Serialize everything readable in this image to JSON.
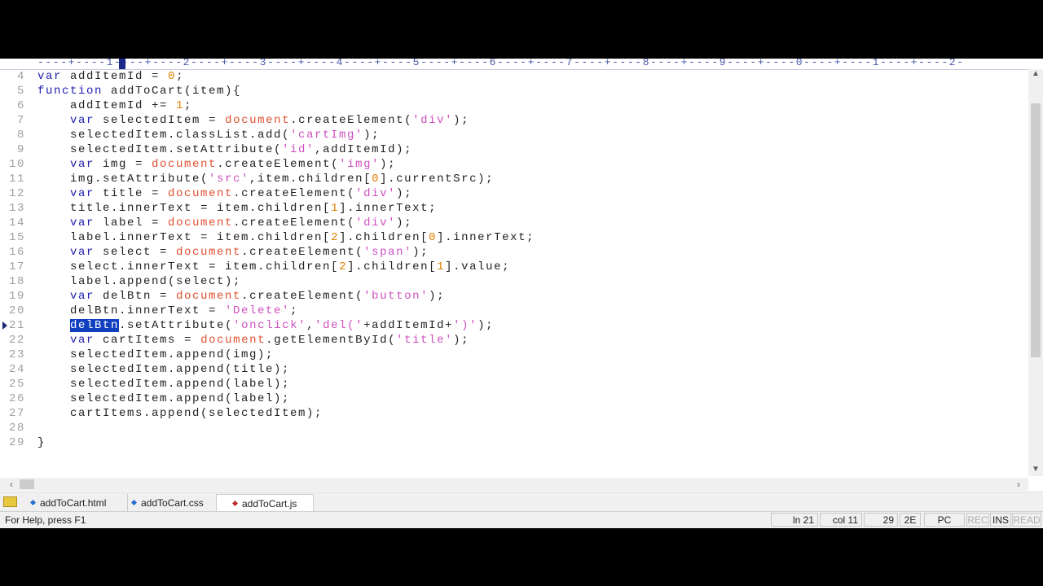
{
  "ruler": "----+----1----+----2----+----3----+----4----+----5----+----6----+----7----+----8----+----9----+----0----+----1----+----2-",
  "code_lines": [
    {
      "num": "4",
      "tokens": [
        [
          "var",
          "k"
        ],
        [
          " addItemId = ",
          "p"
        ],
        [
          "0",
          "n"
        ],
        [
          ";",
          "p"
        ]
      ]
    },
    {
      "num": "5",
      "tokens": [
        [
          "function",
          "k"
        ],
        [
          " addToCart(item){",
          "p"
        ]
      ]
    },
    {
      "num": "6",
      "tokens": [
        [
          "    addItemId += ",
          "p"
        ],
        [
          "1",
          "n"
        ],
        [
          ";",
          "p"
        ]
      ]
    },
    {
      "num": "7",
      "tokens": [
        [
          "    ",
          "p"
        ],
        [
          "var",
          "k"
        ],
        [
          " selectedItem = ",
          "p"
        ],
        [
          "document",
          "d"
        ],
        [
          ".createElement(",
          "p"
        ],
        [
          "'div'",
          "s"
        ],
        [
          ");",
          "p"
        ]
      ]
    },
    {
      "num": "8",
      "tokens": [
        [
          "    selectedItem.classList.add(",
          "p"
        ],
        [
          "'cartImg'",
          "s"
        ],
        [
          ");",
          "p"
        ]
      ]
    },
    {
      "num": "9",
      "tokens": [
        [
          "    selectedItem.setAttribute(",
          "p"
        ],
        [
          "'id'",
          "s"
        ],
        [
          ",addItemId);",
          "p"
        ]
      ]
    },
    {
      "num": "10",
      "tokens": [
        [
          "    ",
          "p"
        ],
        [
          "var",
          "k"
        ],
        [
          " img = ",
          "p"
        ],
        [
          "document",
          "d"
        ],
        [
          ".createElement(",
          "p"
        ],
        [
          "'img'",
          "s"
        ],
        [
          ");",
          "p"
        ]
      ]
    },
    {
      "num": "11",
      "tokens": [
        [
          "    img.setAttribute(",
          "p"
        ],
        [
          "'src'",
          "s"
        ],
        [
          ",item.children[",
          "p"
        ],
        [
          "0",
          "n"
        ],
        [
          "].currentSrc);",
          "p"
        ]
      ]
    },
    {
      "num": "12",
      "tokens": [
        [
          "    ",
          "p"
        ],
        [
          "var",
          "k"
        ],
        [
          " title = ",
          "p"
        ],
        [
          "document",
          "d"
        ],
        [
          ".createElement(",
          "p"
        ],
        [
          "'div'",
          "s"
        ],
        [
          ");",
          "p"
        ]
      ]
    },
    {
      "num": "13",
      "tokens": [
        [
          "    title.innerText = item.children[",
          "p"
        ],
        [
          "1",
          "n"
        ],
        [
          "].innerText;",
          "p"
        ]
      ]
    },
    {
      "num": "14",
      "tokens": [
        [
          "    ",
          "p"
        ],
        [
          "var",
          "k"
        ],
        [
          " label = ",
          "p"
        ],
        [
          "document",
          "d"
        ],
        [
          ".createElement(",
          "p"
        ],
        [
          "'div'",
          "s"
        ],
        [
          ");",
          "p"
        ]
      ]
    },
    {
      "num": "15",
      "tokens": [
        [
          "    label.innerText = item.children[",
          "p"
        ],
        [
          "2",
          "n"
        ],
        [
          "].children[",
          "p"
        ],
        [
          "0",
          "n"
        ],
        [
          "].innerText;",
          "p"
        ]
      ]
    },
    {
      "num": "16",
      "tokens": [
        [
          "    ",
          "p"
        ],
        [
          "var",
          "k"
        ],
        [
          " select = ",
          "p"
        ],
        [
          "document",
          "d"
        ],
        [
          ".createElement(",
          "p"
        ],
        [
          "'span'",
          "s"
        ],
        [
          ");",
          "p"
        ]
      ]
    },
    {
      "num": "17",
      "tokens": [
        [
          "    select.innerText = item.children[",
          "p"
        ],
        [
          "2",
          "n"
        ],
        [
          "].children[",
          "p"
        ],
        [
          "1",
          "n"
        ],
        [
          "].value;",
          "p"
        ]
      ]
    },
    {
      "num": "18",
      "tokens": [
        [
          "    label.append(select);",
          "p"
        ]
      ]
    },
    {
      "num": "19",
      "tokens": [
        [
          "    ",
          "p"
        ],
        [
          "var",
          "k"
        ],
        [
          " delBtn = ",
          "p"
        ],
        [
          "document",
          "d"
        ],
        [
          ".createElement(",
          "p"
        ],
        [
          "'button'",
          "s"
        ],
        [
          ");",
          "p"
        ]
      ]
    },
    {
      "num": "20",
      "tokens": [
        [
          "    delBtn.innerText = ",
          "p"
        ],
        [
          "'Delete'",
          "s"
        ],
        [
          ";",
          "p"
        ]
      ]
    },
    {
      "num": "21",
      "marker": true,
      "tokens": [
        [
          "    ",
          "p"
        ],
        [
          "delBtn",
          "sel"
        ],
        [
          ".setAttribute(",
          "p"
        ],
        [
          "'onclick'",
          "s"
        ],
        [
          ",",
          "p"
        ],
        [
          "'del('",
          "s"
        ],
        [
          "+addItemId+",
          "p"
        ],
        [
          "')'",
          "s"
        ],
        [
          ");",
          "p"
        ]
      ]
    },
    {
      "num": "22",
      "tokens": [
        [
          "    ",
          "p"
        ],
        [
          "var",
          "k"
        ],
        [
          " cartItems = ",
          "p"
        ],
        [
          "document",
          "d"
        ],
        [
          ".getElementById(",
          "p"
        ],
        [
          "'title'",
          "s"
        ],
        [
          ");",
          "p"
        ]
      ]
    },
    {
      "num": "23",
      "tokens": [
        [
          "    selectedItem.append(img);",
          "p"
        ]
      ]
    },
    {
      "num": "24",
      "tokens": [
        [
          "    selectedItem.append(title);",
          "p"
        ]
      ]
    },
    {
      "num": "25",
      "tokens": [
        [
          "    selectedItem.append(label);",
          "p"
        ]
      ]
    },
    {
      "num": "26",
      "tokens": [
        [
          "    selectedItem.append(label);",
          "p"
        ]
      ]
    },
    {
      "num": "27",
      "tokens": [
        [
          "    cartItems.append(selectedItem);",
          "p"
        ]
      ]
    },
    {
      "num": "28",
      "tokens": []
    },
    {
      "num": "29",
      "tokens": [
        [
          "}",
          "p"
        ]
      ]
    }
  ],
  "tabs": [
    {
      "label": "addToCart.html",
      "color": "#2a70d0"
    },
    {
      "label": "addToCart.css",
      "color": "#2a70d0"
    },
    {
      "label": "addToCart.js",
      "color": "#c03030",
      "active": true
    }
  ],
  "status": {
    "help": "For Help, press F1",
    "line": "ln 21",
    "col": "col 11",
    "char_dec": "29",
    "char_hex": "2E",
    "format": "PC",
    "rec": "REC",
    "ins": "INS",
    "read": "READ"
  }
}
